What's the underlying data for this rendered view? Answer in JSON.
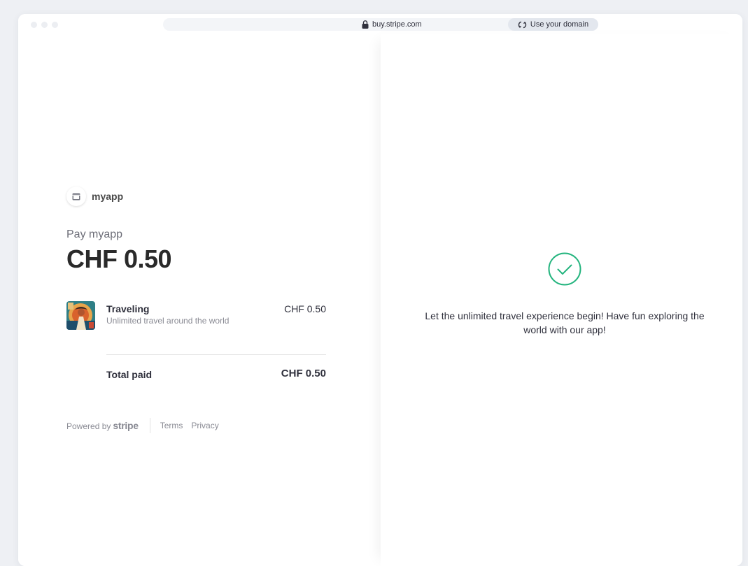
{
  "browser": {
    "url": "buy.stripe.com",
    "domain_button_label": "Use your domain"
  },
  "merchant": {
    "name": "myapp",
    "icon": "store-icon"
  },
  "payment": {
    "pay_label": "Pay myapp",
    "amount": "CHF 0.50"
  },
  "line_item": {
    "name": "Traveling",
    "description": "Unlimited travel around the world",
    "price": "CHF 0.50"
  },
  "total": {
    "label": "Total paid",
    "value": "CHF 0.50"
  },
  "footer": {
    "powered_by": "Powered by",
    "brand": "stripe",
    "links": [
      "Terms",
      "Privacy"
    ]
  },
  "confirmation": {
    "message": "Let the unlimited travel experience begin! Have fun exploring the world with our app!",
    "icon": "checkmark-circle-icon",
    "accent_color": "#24b47e"
  }
}
